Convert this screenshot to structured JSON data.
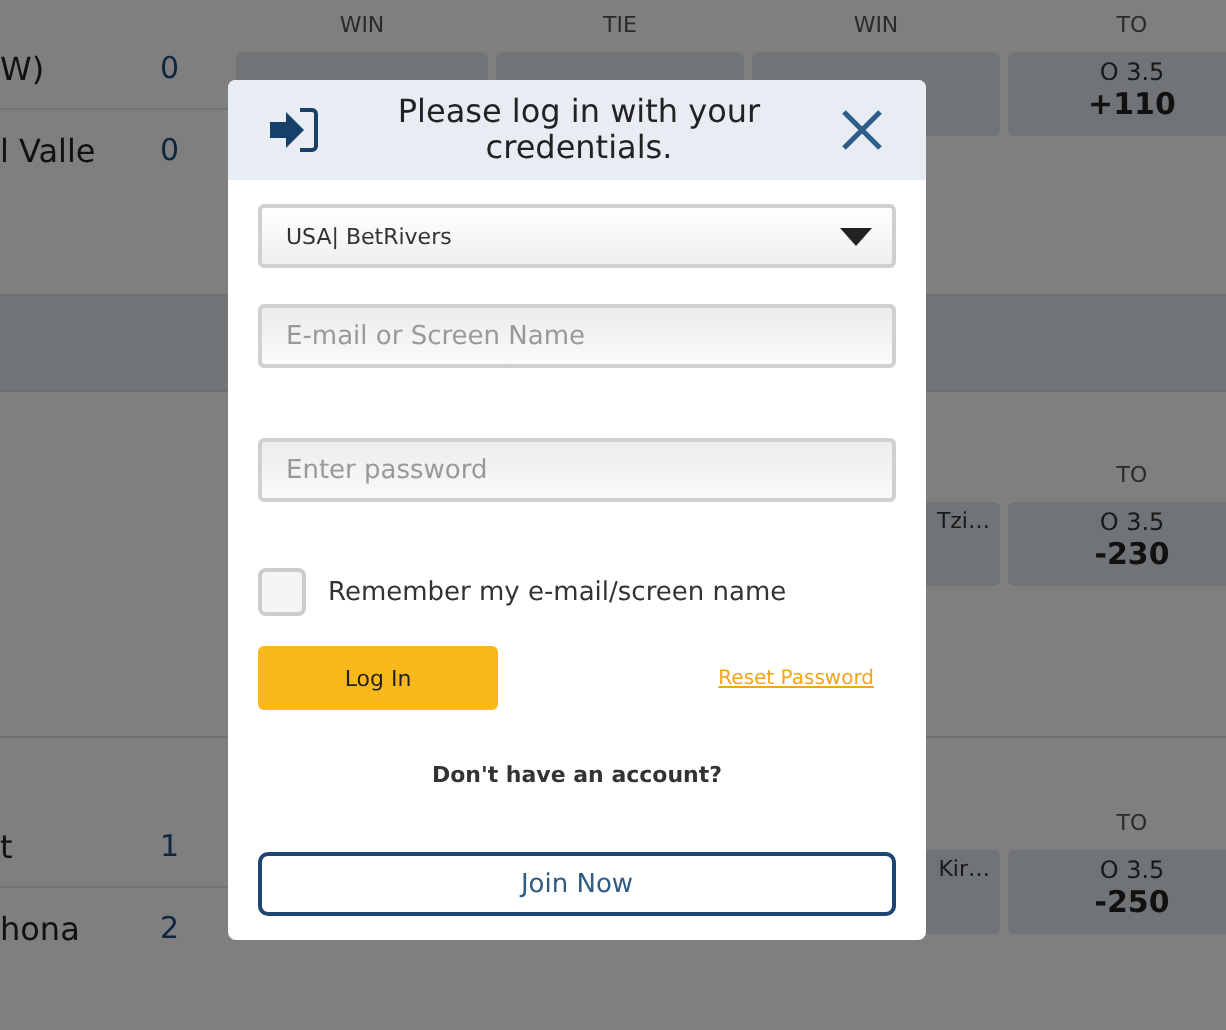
{
  "background": {
    "matches": [
      {
        "headers": [
          "WIN",
          "TIE",
          "WIN",
          "TO"
        ],
        "teams": [
          {
            "name": "W)",
            "score": "0"
          },
          {
            "name": "l Valle",
            "score": "0"
          }
        ],
        "odds": [
          {
            "label": "O 3.5",
            "price": "+110"
          }
        ]
      },
      {
        "headers": [
          "TO"
        ],
        "odds": [
          {
            "label": "Tzi…"
          },
          {
            "label": "O 3.5",
            "price": "-230"
          }
        ]
      },
      {
        "headers": [
          "TO"
        ],
        "teams": [
          {
            "name": "t",
            "score": "1"
          },
          {
            "name": "hona",
            "score": "2"
          }
        ],
        "odds": [
          {
            "label": "Kir…"
          },
          {
            "label": "O 3.5",
            "price": "-250"
          }
        ]
      }
    ]
  },
  "modal": {
    "title": "Please log in with your credentials.",
    "site_select": "USA| BetRivers",
    "email": {
      "placeholder": "E-mail or Screen Name"
    },
    "password": {
      "placeholder": "Enter password"
    },
    "remember": {
      "label": "Remember my e-mail/screen name",
      "checked": false
    },
    "login_button": "Log In",
    "reset_link": "Reset Password",
    "signup_prompt": "Don't have an account?",
    "join_button": "Join Now"
  }
}
